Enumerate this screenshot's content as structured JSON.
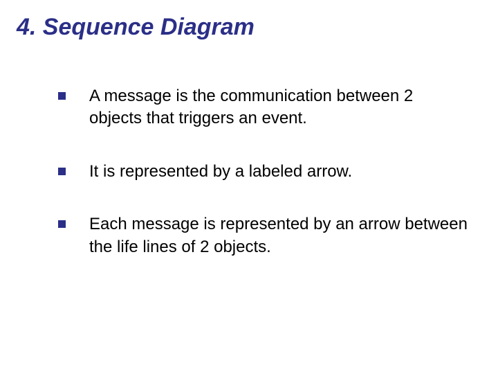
{
  "slide": {
    "title": "4. Sequence Diagram",
    "bullets": [
      {
        "text": "A message is the communication between 2 objects that triggers an event."
      },
      {
        "text": "It is represented by a labeled arrow."
      },
      {
        "text": "Each message is represented by an arrow between the life lines of 2 objects."
      }
    ]
  }
}
